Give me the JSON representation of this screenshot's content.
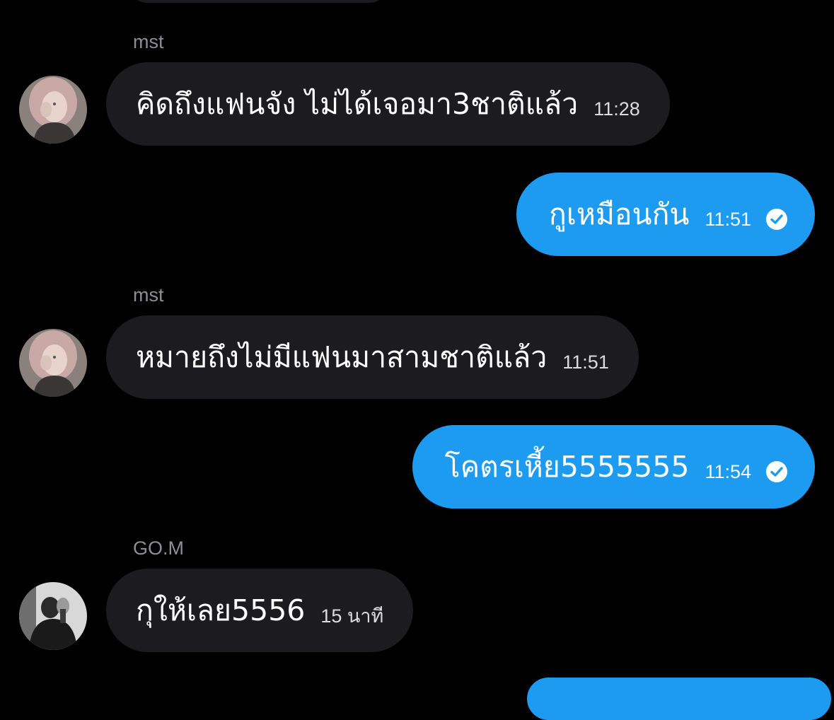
{
  "colors": {
    "background": "#000000",
    "incoming_bubble": "#1c1c1e",
    "outgoing_bubble": "#1d9bf0",
    "sender_name": "#8e8e93",
    "text": "#ffffff"
  },
  "messages": [
    {
      "direction": "incoming",
      "sender": "mst",
      "avatar_icon": "user-avatar-photo",
      "text": "คิดถึงแฟนจัง ไม่ได้เจอมา3ชาติแล้ว",
      "time": "11:28"
    },
    {
      "direction": "outgoing",
      "text": "กูเหมือนกัน",
      "time": "11:51",
      "status_icon": "read-check-icon"
    },
    {
      "direction": "incoming",
      "sender": "mst",
      "avatar_icon": "user-avatar-photo",
      "text": "หมายถึงไม่มีแฟนมาสามชาติแล้ว",
      "time": "11:51"
    },
    {
      "direction": "outgoing",
      "text": "โคตรเหี้ย5555555",
      "time": "11:54",
      "status_icon": "read-check-icon"
    },
    {
      "direction": "incoming",
      "sender": "GO.M",
      "avatar_icon": "user-avatar-photo",
      "text": "กุให้เลย5556",
      "time": "15 นาที"
    }
  ]
}
